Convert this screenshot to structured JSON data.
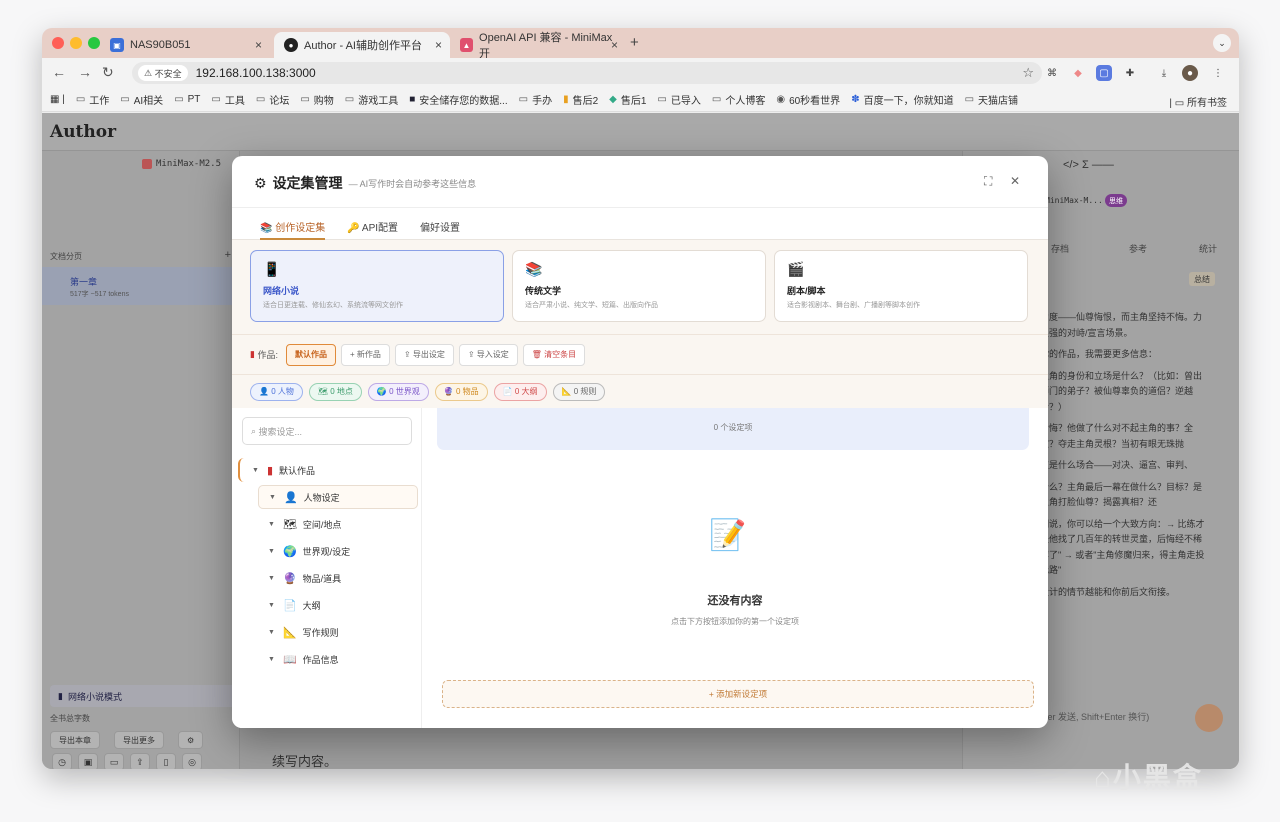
{
  "browser": {
    "tabs": [
      {
        "title": "NAS90B051",
        "favicon": "nas-icon",
        "color": "#3b6fd8"
      },
      {
        "title": "Author - AI辅助创作平台",
        "favicon": "author-icon",
        "color": "#222222"
      },
      {
        "title": "OpenAI API 兼容 - MiniMax 开",
        "favicon": "minimax-icon",
        "color": "#e0506e"
      }
    ],
    "close_label": "×",
    "newtab_label": "+",
    "menu_label": "⌄",
    "insecure_label": "不安全",
    "url": "192.168.100.138:3000",
    "bookmarks": [
      "工作",
      "AI相关",
      "PT",
      "工具",
      "论坛",
      "购物",
      "游戏工具",
      "安全储存您的数据...",
      "手办",
      "售后2",
      "售后1",
      "已导入",
      "个人博客",
      "60秒看世界",
      "百度一下，你就知道",
      "天猫店铺"
    ],
    "all_bookmarks": "所有书签"
  },
  "app": {
    "logo": "Author",
    "model": "MiniMax-M2.5",
    "doc_label": "文档分页",
    "add_label": "+",
    "chapter_title": "第一章",
    "chapter_stats": "517字 ~517 tokens",
    "mode_label": "网络小说模式",
    "wordcount_label": "全书总字数",
    "left_buttons": [
      "导出本章",
      "导出更多"
    ],
    "content_text": "续写内容。",
    "right_tools": "</>  Σ  ——",
    "right_model": "MiniMax-M...",
    "right_badge": "思维",
    "right_tabs": [
      "存档",
      "参考",
      "统计"
    ],
    "summary_label": "总结",
    "chat_lines": [
      "力度——仙尊悔恨，而主角坚持不悔。力很强的对峙/宣言场景。",
      "你的作品，我需要更多信息：",
      "主角的身份和立场是什么？（比如：曾出师门的弟子？被仙尊辜负的道侣？逆越者？）",
      "后悔？他做了什么对不起主角的事？全家？夺走主角灵根？当初有眼无珠抛",
      "这是什么场合——对决、逼宫、审判、",
      "什么？主角最后一幕在做什么？目标？是主角打脸仙尊？揭露真相？还",
      "细说，你可以给一个大致方向：→ 比练才是他找了几百年的转世灵童，后悔经不稀罕了\" → 或者\"主角修魔归来，得主角走投无路\"",
      "设计的情节越能和你前后文衔接。"
    ],
    "copy_label": "复制",
    "send_hint": "nter 发送, Shift+Enter 换行)"
  },
  "modal": {
    "title": "设定集管理",
    "subtitle": "— AI写作时会自动参考这些信息",
    "tabs": [
      "创作设定集",
      "API配置",
      "偏好设置"
    ],
    "genres": [
      {
        "icon": "📱",
        "title": "网络小说",
        "desc": "适合日更连载、修仙玄幻、系统流等网文创作",
        "selected": true
      },
      {
        "icon": "📚",
        "title": "传统文学",
        "desc": "适合严肃小说、纯文学、短篇、出版向作品",
        "selected": false
      },
      {
        "icon": "🎬",
        "title": "剧本/脚本",
        "desc": "适合影视剧本、舞台剧、广播剧等脚本创作",
        "selected": false
      }
    ],
    "work_label": "作品:",
    "current_work": "默认作品",
    "work_buttons": [
      "+ 新作品",
      "导出设定",
      "导入设定",
      "清空条目"
    ],
    "chips": [
      {
        "label": "0 人物",
        "color": "#4a6fd8",
        "bg": "#edf2fd"
      },
      {
        "label": "0 地点",
        "color": "#3c9c6c",
        "bg": "#ecf8f1"
      },
      {
        "label": "0 世界观",
        "color": "#7a55c8",
        "bg": "#f3effc"
      },
      {
        "label": "0 物品",
        "color": "#d08a20",
        "bg": "#fdf5e6"
      },
      {
        "label": "0 大纲",
        "color": "#d04a4a",
        "bg": "#fdeeee"
      },
      {
        "label": "0 规则",
        "color": "#666666",
        "bg": "#f4f4f4"
      }
    ],
    "search_placeholder": "搜索设定...",
    "tree_root": "默认作品",
    "tree_items": [
      {
        "icon": "👤",
        "label": "人物设定"
      },
      {
        "icon": "🗺",
        "label": "空间/地点"
      },
      {
        "icon": "🌍",
        "label": "世界观/设定"
      },
      {
        "icon": "🔮",
        "label": "物品/道具"
      },
      {
        "icon": "📄",
        "label": "大纲"
      },
      {
        "icon": "📐",
        "label": "写作规则"
      },
      {
        "icon": "📖",
        "label": "作品信息"
      }
    ],
    "group_count": "0 个设定项",
    "empty_title": "还没有内容",
    "empty_sub": "点击下方按钮添加你的第一个设定项",
    "add_button": "+ 添加新设定项"
  },
  "watermark": "小黑盒"
}
